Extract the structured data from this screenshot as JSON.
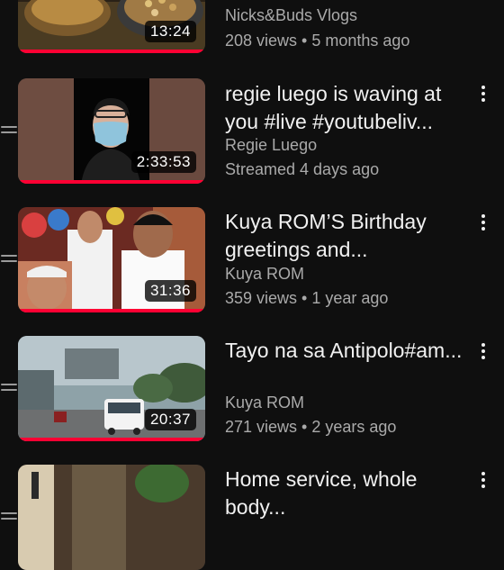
{
  "videos": [
    {
      "title": "",
      "channel": "Nicks&Buds Vlogs",
      "meta": "208 views • 5 months ago",
      "duration": "13:24",
      "watched_fraction": 1.0
    },
    {
      "title": "regie luego is waving at you #live #youtubeliv...",
      "channel": "Regie Luego",
      "meta": "Streamed 4 days ago",
      "duration": "2:33:53",
      "watched_fraction": 1.0
    },
    {
      "title": "Kuya ROM’S Birthday greetings and...",
      "channel": "Kuya ROM",
      "meta": "359 views • 1 year ago",
      "duration": "31:36",
      "watched_fraction": 1.0
    },
    {
      "title": "Tayo na sa Antipolo#am...",
      "channel": "Kuya ROM",
      "meta": "271 views • 2 years ago",
      "duration": "20:37",
      "watched_fraction": 1.0
    },
    {
      "title": "Home service, whole body...",
      "channel": "",
      "meta": "",
      "duration": "",
      "watched_fraction": 0
    }
  ],
  "icons": {
    "drag": "drag-handle-icon",
    "more": "more-vert-icon"
  },
  "colors": {
    "background": "#0f0f0f",
    "progress": "#ff0033",
    "secondary_text": "#aaaaaa"
  }
}
